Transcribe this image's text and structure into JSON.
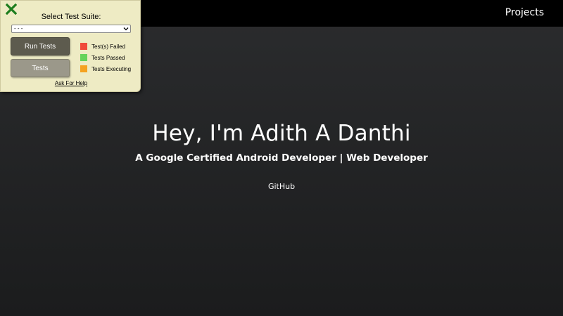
{
  "nav": {
    "projects_label": "Projects"
  },
  "hero": {
    "title": "Hey, I'm Adith A Danthi",
    "subtitle": "A Google Certified Android Developer | Web Developer",
    "github_label": "GitHub"
  },
  "test_panel": {
    "close_icon": "close-x-icon",
    "title": "Select Test Suite:",
    "selected_suite": "- - -",
    "run_button_label": "Run Tests",
    "tests_button_label": "Tests",
    "legend": [
      {
        "label": "Test(s) Failed",
        "color": "#f04b3c"
      },
      {
        "label": "Tests Passed",
        "color": "#66d35a"
      },
      {
        "label": "Tests Executing",
        "color": "#f5a21f"
      }
    ],
    "help_label": "Ask For Help"
  },
  "colors": {
    "panel_background": "#eeebc4",
    "close_icon": "#1e7d1e",
    "topbar": "#000000"
  }
}
